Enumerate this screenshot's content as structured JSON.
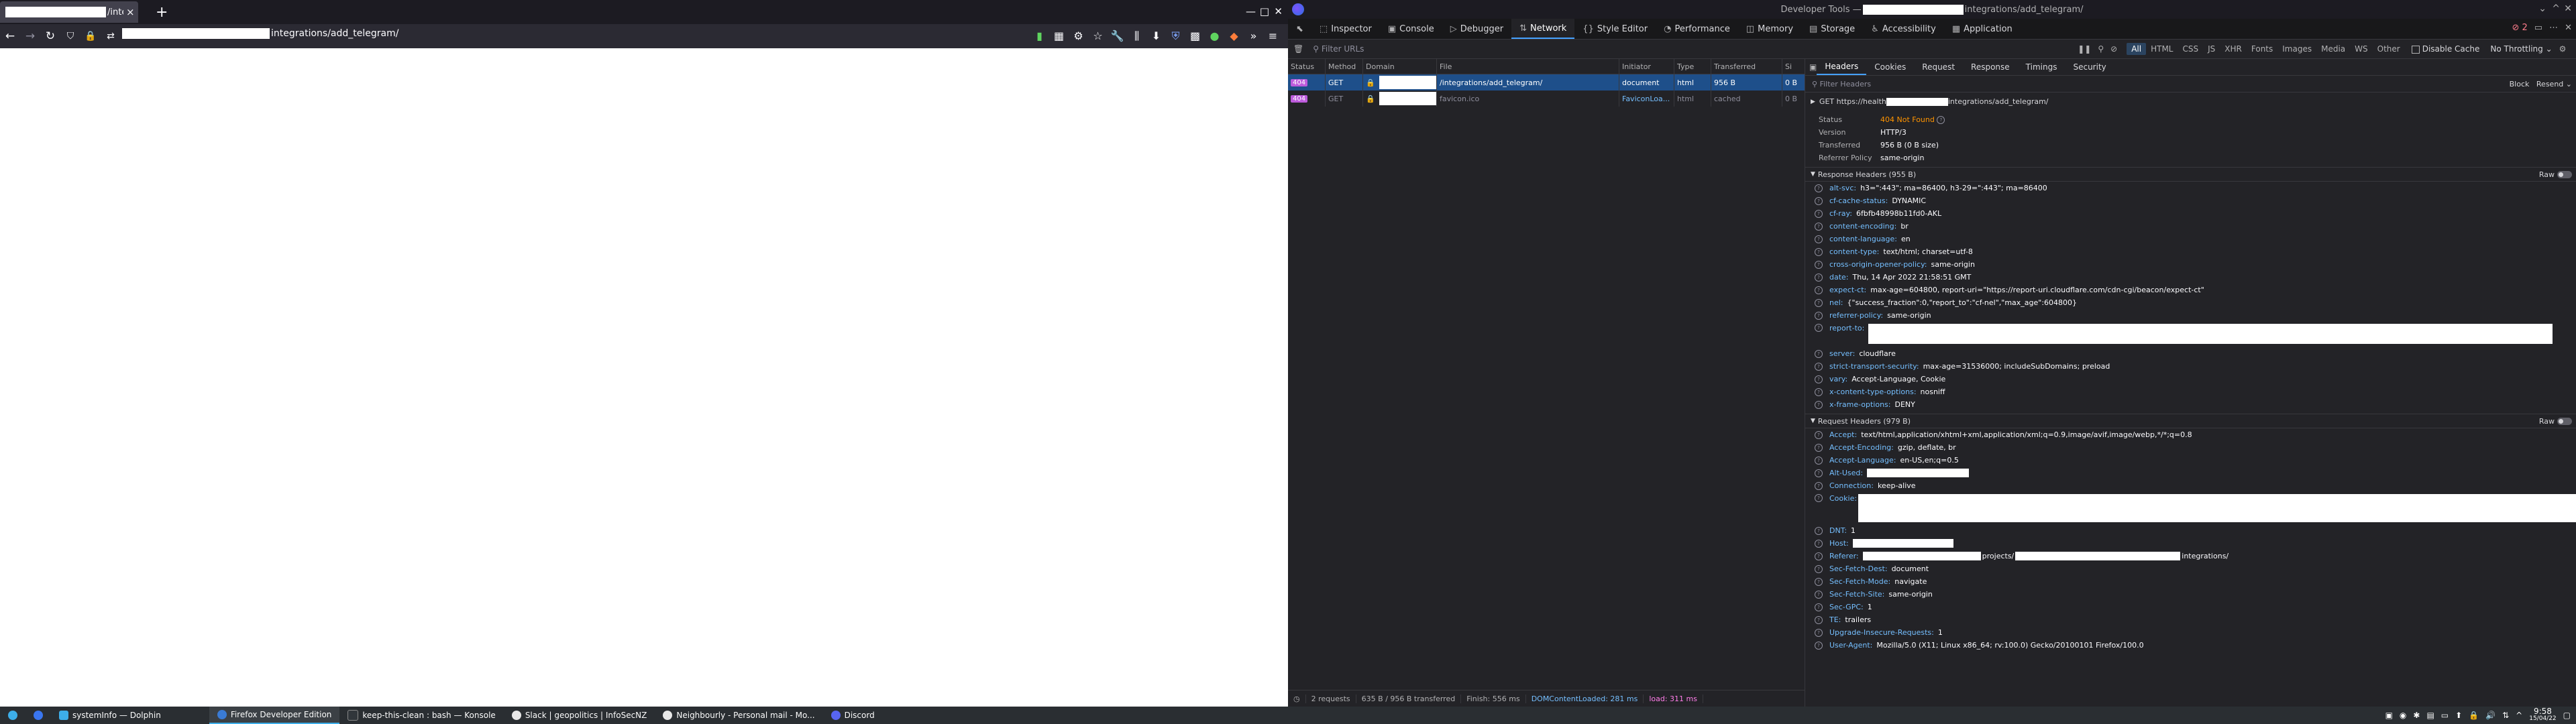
{
  "browser": {
    "tab_title_suffix": "/inte",
    "tab_close": "×",
    "new_tab": "+",
    "url_path": "integrations/add_telegram/"
  },
  "devtools": {
    "title_prefix": "Developer Tools — ",
    "title_suffix": "integrations/add_telegram/",
    "tabs": [
      {
        "label": "Inspector",
        "icon": "⬚"
      },
      {
        "label": "Console",
        "icon": "▣"
      },
      {
        "label": "Debugger",
        "icon": "▷"
      },
      {
        "label": "Network",
        "icon": "⇅"
      },
      {
        "label": "Style Editor",
        "icon": "{}"
      },
      {
        "label": "Performance",
        "icon": "◔"
      },
      {
        "label": "Memory",
        "icon": "◫"
      },
      {
        "label": "Storage",
        "icon": "▤"
      },
      {
        "label": "Accessibility",
        "icon": "♿"
      },
      {
        "label": "Application",
        "icon": "▦"
      }
    ],
    "error_count": "2",
    "filter_placeholder": "Filter URLs",
    "pause_label": "❚❚",
    "type_filters": [
      "All",
      "HTML",
      "CSS",
      "JS",
      "XHR",
      "Fonts",
      "Images",
      "Media",
      "WS",
      "Other"
    ],
    "disable_cache": "Disable Cache",
    "throttling": "No Throttling ⌄",
    "columns": [
      "Status",
      "Method",
      "Domain",
      "File",
      "Initiator",
      "Type",
      "Transferred",
      "Si"
    ],
    "requests": [
      {
        "status": "404",
        "method": "GET",
        "file": "/integrations/add_telegram/",
        "initiator": "document",
        "type": "html",
        "transferred": "956 B",
        "size": "0 B"
      },
      {
        "status": "404",
        "method": "GET",
        "file": "favicon.ico",
        "initiator": "FaviconLoa...",
        "type": "html",
        "transferred": "cached",
        "size": "0 B"
      }
    ],
    "summary": {
      "requests": "2 requests",
      "transferred": "635 B / 956 B transferred",
      "finish": "Finish: 556 ms",
      "dcl": "DOMContentLoaded: 281 ms",
      "load": "load: 311 ms"
    }
  },
  "panel": {
    "tabs": [
      "Headers",
      "Cookies",
      "Request",
      "Response",
      "Timings",
      "Security"
    ],
    "filter_placeholder": "Filter Headers",
    "block": "Block",
    "resend": "Resend ⌄",
    "request_line_prefix": "GET  https://health",
    "request_line_suffix": "integrations/add_telegram/",
    "summary": [
      {
        "label": "Status",
        "value": "404 Not Found"
      },
      {
        "label": "Version",
        "value": "HTTP/3"
      },
      {
        "label": "Transferred",
        "value": "956 B (0 B size)"
      },
      {
        "label": "Referrer Policy",
        "value": "same-origin"
      }
    ],
    "response_title": "Response Headers (955 B)",
    "raw": "Raw",
    "response_headers": [
      {
        "name": "alt-svc:",
        "value": "h3=\":443\"; ma=86400, h3-29=\":443\"; ma=86400"
      },
      {
        "name": "cf-cache-status:",
        "value": "DYNAMIC"
      },
      {
        "name": "cf-ray:",
        "value": "6fbfb48998b11fd0-AKL"
      },
      {
        "name": "content-encoding:",
        "value": "br"
      },
      {
        "name": "content-language:",
        "value": "en"
      },
      {
        "name": "content-type:",
        "value": "text/html; charset=utf-8"
      },
      {
        "name": "cross-origin-opener-policy:",
        "value": "same-origin"
      },
      {
        "name": "date:",
        "value": "Thu, 14 Apr 2022 21:58:51 GMT"
      },
      {
        "name": "expect-ct:",
        "value": "max-age=604800, report-uri=\"https://report-uri.cloudflare.com/cdn-cgi/beacon/expect-ct\""
      },
      {
        "name": "nel:",
        "value": "{\"success_fraction\":0,\"report_to\":\"cf-nel\",\"max_age\":604800}"
      },
      {
        "name": "referrer-policy:",
        "value": "same-origin"
      },
      {
        "name": "report-to:",
        "value": ""
      },
      {
        "name": "server:",
        "value": "cloudflare"
      },
      {
        "name": "strict-transport-security:",
        "value": "max-age=31536000; includeSubDomains; preload"
      },
      {
        "name": "vary:",
        "value": "Accept-Language, Cookie"
      },
      {
        "name": "x-content-type-options:",
        "value": "nosniff"
      },
      {
        "name": "x-frame-options:",
        "value": "DENY"
      }
    ],
    "request_title": "Request Headers (979 B)",
    "request_headers": [
      {
        "name": "Accept:",
        "value": "text/html,application/xhtml+xml,application/xml;q=0.9,image/avif,image/webp,*/*;q=0.8"
      },
      {
        "name": "Accept-Encoding:",
        "value": "gzip, deflate, br"
      },
      {
        "name": "Accept-Language:",
        "value": "en-US,en;q=0.5"
      },
      {
        "name": "Alt-Used:",
        "value": ""
      },
      {
        "name": "Connection:",
        "value": "keep-alive"
      },
      {
        "name": "Cookie:",
        "value": ""
      },
      {
        "name": "DNT:",
        "value": "1"
      },
      {
        "name": "Host:",
        "value": ""
      },
      {
        "name": "Referer:",
        "value": ""
      },
      {
        "name": "Sec-Fetch-Dest:",
        "value": "document"
      },
      {
        "name": "Sec-Fetch-Mode:",
        "value": "navigate"
      },
      {
        "name": "Sec-Fetch-Site:",
        "value": "same-origin"
      },
      {
        "name": "Sec-GPC:",
        "value": "1"
      },
      {
        "name": "TE:",
        "value": "trailers"
      },
      {
        "name": "Upgrade-Insecure-Requests:",
        "value": "1"
      },
      {
        "name": "User-Agent:",
        "value": "Mozilla/5.0 (X11; Linux x86_64; rv:100.0) Gecko/20100101 Firefox/100.0"
      }
    ],
    "referer_mid": "projects/",
    "referer_end": "integrations/"
  },
  "taskbar": {
    "items": [
      {
        "label": "systemInfo — Dolphin",
        "color": "#3daee9"
      },
      {
        "label": "Firefox Developer Edition",
        "color": "#3a7bd5"
      },
      {
        "label": "keep-this-clean : bash — Konsole",
        "color": "#31363b"
      },
      {
        "label": "Slack | geopolitics | InfoSecNZ",
        "color": "#e8e8e8"
      },
      {
        "label": "Neighbourly - Personal mail - Mo...",
        "color": "#e8e8e8"
      },
      {
        "label": "Discord",
        "color": "#5865f2"
      }
    ],
    "time": "9:58",
    "date": "15/04/22"
  }
}
